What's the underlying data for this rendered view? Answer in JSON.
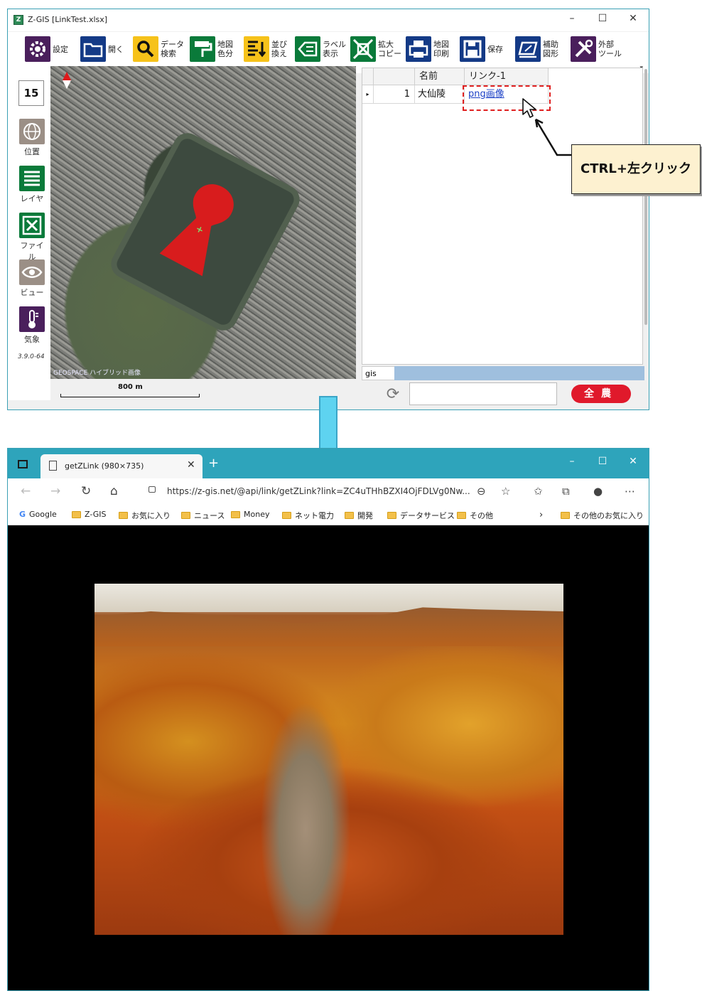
{
  "zgis": {
    "title": "Z-GIS [LinkTest.xlsx]",
    "window_controls": {
      "minimize": "–",
      "maximize": "☐",
      "close": "✕"
    },
    "toolbar": [
      {
        "id": "settings",
        "label": "設定",
        "icon": "gear-icon"
      },
      {
        "id": "open",
        "label": "開く",
        "icon": "folder-open-icon"
      },
      {
        "id": "data-search",
        "label": "データ\n検索",
        "icon": "magnifier-icon"
      },
      {
        "id": "map-color",
        "label": "地図\n色分",
        "icon": "paint-roller-icon"
      },
      {
        "id": "sort",
        "label": "並び\n換え",
        "icon": "sort-icon"
      },
      {
        "id": "label",
        "label": "ラベル\n表示",
        "icon": "label-tag-icon"
      },
      {
        "id": "zoom-copy",
        "label": "拡大\nコピー",
        "icon": "expand-icon"
      },
      {
        "id": "print",
        "label": "地図\n印刷",
        "icon": "printer-icon"
      },
      {
        "id": "save",
        "label": "保存",
        "icon": "floppy-disk-icon"
      },
      {
        "id": "aux-shape",
        "label": "補助\n図形",
        "icon": "shape-icon"
      },
      {
        "id": "external-tools",
        "label": "外部\nツール",
        "icon": "tools-icon"
      }
    ],
    "zoom_level": "15",
    "side_buttons": [
      {
        "id": "position",
        "label": "位置",
        "icon": "globe-icon"
      },
      {
        "id": "layer",
        "label": "レイヤ",
        "icon": "layers-icon"
      },
      {
        "id": "file",
        "label": "ファイル",
        "icon": "excel-icon"
      },
      {
        "id": "view",
        "label": "ビュー",
        "icon": "eye-icon"
      },
      {
        "id": "weather",
        "label": "気象",
        "icon": "thermometer-icon"
      }
    ],
    "version": "3.9.0-64",
    "map": {
      "copyright": "GEOSPACE ハイブリッド画像",
      "scale_label": "800 m"
    },
    "grid": {
      "headers": [
        "",
        "",
        "名前",
        "リンク-1"
      ],
      "rows": [
        {
          "index": "1",
          "name": "大仙陵",
          "link": "png画像"
        }
      ]
    },
    "sheet_tab": "gis",
    "zenno_button": "全農",
    "colors": {
      "polygon": "#e0191b",
      "accent": "#3aa0b4",
      "highlight_box": "#e02020"
    }
  },
  "callout": {
    "text": "CTRL+左クリック"
  },
  "browser": {
    "tab_title": "getZLink (980×735)",
    "url": "https://z-gis.net/@api/link/getZLink?link=ZC4uTHhBZXI4OjFDLVg0Nw...",
    "window_controls": {
      "minimize": "–",
      "maximize": "☐",
      "close": "✕"
    },
    "bookmarks": [
      {
        "label": "Google",
        "type": "google"
      },
      {
        "label": "Z-GIS",
        "type": "folder"
      },
      {
        "label": "お気に入り",
        "type": "folder"
      },
      {
        "label": "ニュース",
        "type": "folder"
      },
      {
        "label": "Money",
        "type": "folder"
      },
      {
        "label": "ネット電力",
        "type": "folder"
      },
      {
        "label": "開発",
        "type": "folder"
      },
      {
        "label": "データサービス",
        "type": "folder"
      },
      {
        "label": "その他",
        "type": "folder"
      }
    ],
    "other_bookmarks": "その他のお気に入り",
    "accent": "#2ea4bb"
  }
}
